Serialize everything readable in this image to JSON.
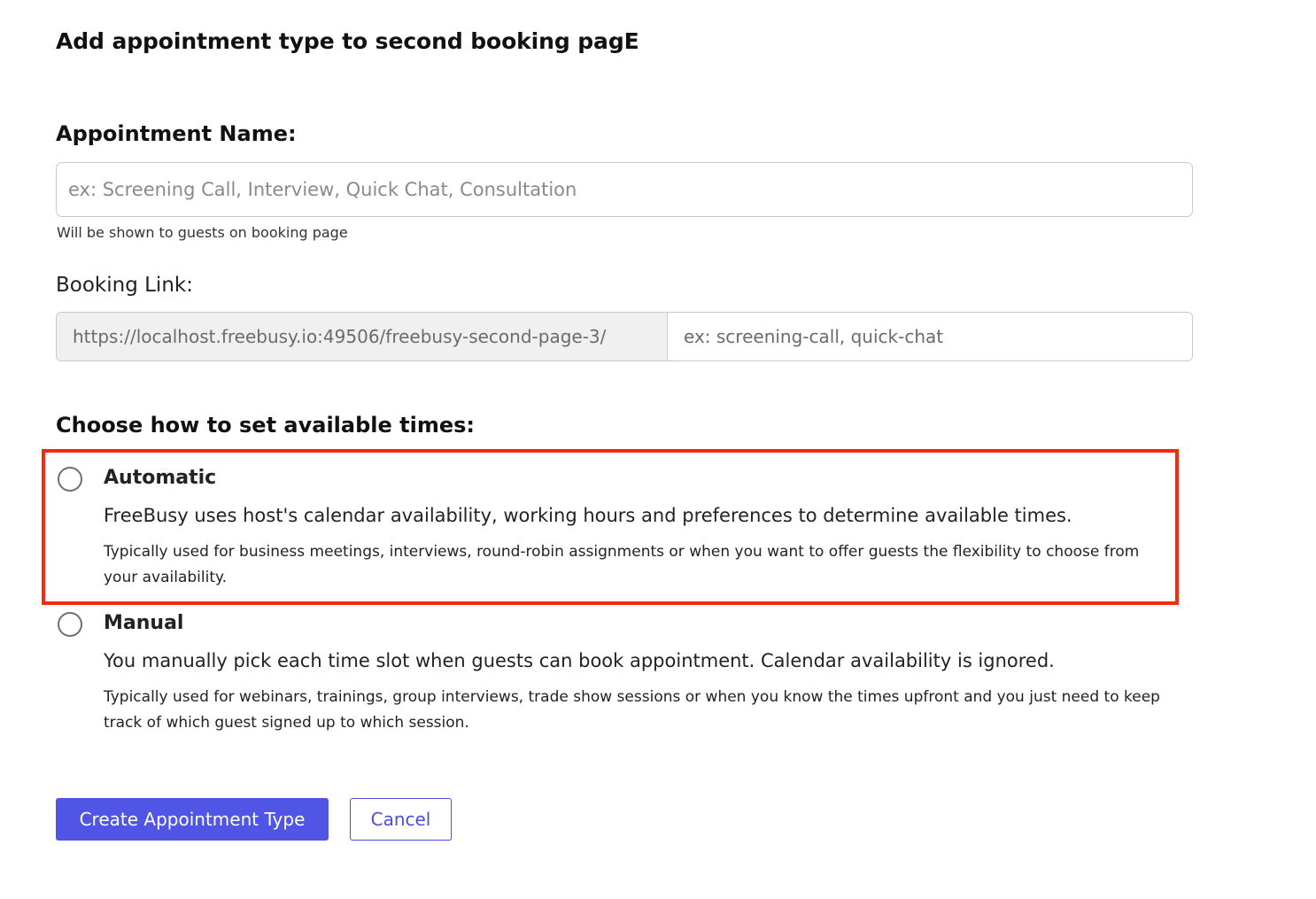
{
  "page": {
    "title": "Add appointment type to second booking pagE"
  },
  "appointment_name": {
    "label": "Appointment Name:",
    "placeholder": "ex: Screening Call, Interview, Quick Chat, Consultation",
    "value": "",
    "hint": "Will be shown to guests on booking page"
  },
  "booking_link": {
    "label": "Booking Link:",
    "prefix": "https://localhost.freebusy.io:49506/freebusy-second-page-3/",
    "placeholder": "ex: screening-call, quick-chat",
    "value": ""
  },
  "availability": {
    "title": "Choose how to set available times:",
    "options": [
      {
        "label": "Automatic",
        "selected": false,
        "description": "FreeBusy uses host's calendar availability, working hours and preferences to determine available times.",
        "note": "Typically used for business meetings, interviews, round-robin assignments or when you want to offer guests the flexibility to choose from your availability."
      },
      {
        "label": "Manual",
        "selected": false,
        "description": "You manually pick each time slot when guests can book appointment. Calendar availability is ignored.",
        "note": "Typically used for webinars, trainings, group interviews, trade show sessions or when you know the times upfront and you just need to keep track of which guest signed up to which session."
      }
    ]
  },
  "actions": {
    "create_label": "Create Appointment Type",
    "cancel_label": "Cancel"
  },
  "colors": {
    "primary": "#5055e6",
    "highlight": "#f52a10"
  }
}
